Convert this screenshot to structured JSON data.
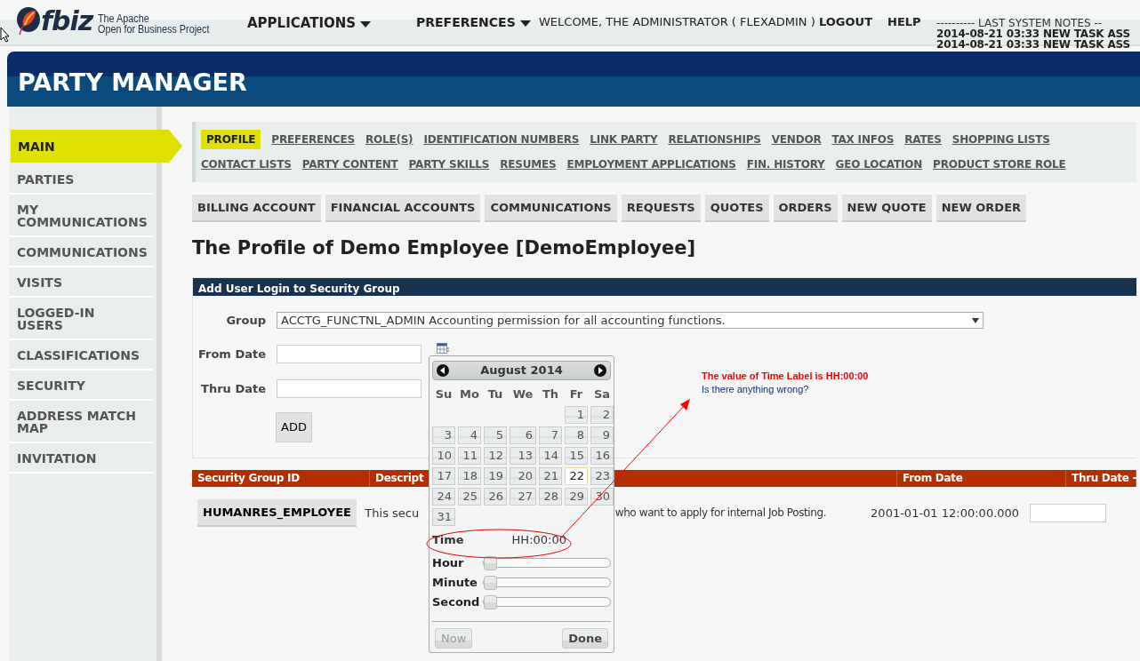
{
  "header": {
    "logo_text": "fbiz",
    "tagline": [
      "The Apache",
      "Open for Business Project"
    ],
    "menus": [
      {
        "label": "APPLICATIONS",
        "kind": "dropdown"
      },
      {
        "label": "PREFERENCES",
        "kind": "dropdown"
      },
      {
        "label": "WELCOME, THE ADMINISTRATOR ( FLEXADMIN )",
        "kind": "text"
      },
      {
        "label": "LOGOUT",
        "kind": "link"
      },
      {
        "label": "HELP",
        "kind": "link"
      }
    ],
    "system_notes": {
      "title": "---------- LAST SYSTEM NOTES --",
      "lines": [
        "2014-08-21 03:33 NEW TASK ASS",
        "2014-08-21 03:33 NEW TASK ASS"
      ]
    }
  },
  "app_title": "PARTY MANAGER",
  "sidebar": {
    "items": [
      {
        "label": "MAIN",
        "selected": true
      },
      {
        "label": "PARTIES",
        "selected": false
      },
      {
        "label": "MY COMMUNICATIONS",
        "selected": false
      },
      {
        "label": "COMMUNICATIONS",
        "selected": false
      },
      {
        "label": "VISITS",
        "selected": false
      },
      {
        "label": "LOGGED-IN USERS",
        "selected": false
      },
      {
        "label": "CLASSIFICATIONS",
        "selected": false
      },
      {
        "label": "SECURITY",
        "selected": false
      },
      {
        "label": "ADDRESS MATCH MAP",
        "selected": false
      },
      {
        "label": "INVITATION",
        "selected": false
      }
    ]
  },
  "tab_rows": [
    [
      {
        "label": "PROFILE",
        "selected": true
      },
      {
        "label": "PREFERENCES",
        "selected": false
      },
      {
        "label": "ROLE(S)",
        "selected": false
      },
      {
        "label": "IDENTIFICATION NUMBERS",
        "selected": false
      },
      {
        "label": "LINK PARTY",
        "selected": false
      },
      {
        "label": "RELATIONSHIPS",
        "selected": false
      },
      {
        "label": "VENDOR",
        "selected": false
      },
      {
        "label": "TAX INFOS",
        "selected": false
      },
      {
        "label": "RATES",
        "selected": false
      },
      {
        "label": "SHOPPING LISTS",
        "selected": false
      }
    ],
    [
      {
        "label": "CONTACT LISTS",
        "selected": false
      },
      {
        "label": "PARTY CONTENT",
        "selected": false
      },
      {
        "label": "PARTY SKILLS",
        "selected": false
      },
      {
        "label": "RESUMES",
        "selected": false
      },
      {
        "label": "EMPLOYMENT APPLICATIONS",
        "selected": false
      },
      {
        "label": "FIN. HISTORY",
        "selected": false
      },
      {
        "label": "GEO LOCATION",
        "selected": false
      },
      {
        "label": "PRODUCT STORE ROLE",
        "selected": false
      }
    ]
  ],
  "buttons": [
    "BILLING ACCOUNT",
    "FINANCIAL ACCOUNTS",
    "COMMUNICATIONS",
    "REQUESTS",
    "QUOTES",
    "ORDERS",
    "NEW QUOTE",
    "NEW ORDER"
  ],
  "page_title": "The Profile of Demo Employee [DemoEmployee]",
  "form": {
    "title": "Add User Login to Security Group",
    "fields": [
      {
        "label": "Group",
        "kind": "select",
        "value": "ACCTG_FUNCTNL_ADMIN Accounting permission for all accounting functions."
      },
      {
        "label": "From Date",
        "kind": "date",
        "picker_icon": true
      },
      {
        "label": "Thru Date",
        "kind": "date",
        "picker_icon": false
      }
    ],
    "submit": "ADD"
  },
  "table": {
    "columns": [
      "Security Group ID",
      "Descript",
      "From Date",
      "Thru Date -"
    ],
    "rows": [
      {
        "group_id": "HUMANRES_EMPLOYEE",
        "description_parts": [
          "This secu",
          "who want to apply for internal Job Posting."
        ],
        "from_date": "2001-01-01 12:00:00.000"
      }
    ]
  },
  "calendar": {
    "title": "August 2014",
    "weekdays": [
      "Su",
      "Mo",
      "Tu",
      "We",
      "Th",
      "Fr",
      "Sa"
    ],
    "weeks": [
      [
        {
          "label": "1",
          "today": false
        },
        {
          "label": "2",
          "today": false
        }
      ],
      [
        {
          "label": "3",
          "today": false
        },
        {
          "label": "4",
          "today": false
        },
        {
          "label": "5",
          "today": false
        },
        {
          "label": "6",
          "today": false
        },
        {
          "label": "7",
          "today": false
        },
        {
          "label": "8",
          "today": false
        },
        {
          "label": "9",
          "today": false
        }
      ],
      [
        {
          "label": "10",
          "today": false
        },
        {
          "label": "11",
          "today": false
        },
        {
          "label": "12",
          "today": false
        },
        {
          "label": "13",
          "today": false
        },
        {
          "label": "14",
          "today": false
        },
        {
          "label": "15",
          "today": false
        },
        {
          "label": "16",
          "today": false
        }
      ],
      [
        {
          "label": "17",
          "today": false
        },
        {
          "label": "18",
          "today": false
        },
        {
          "label": "19",
          "today": false
        },
        {
          "label": "20",
          "today": false
        },
        {
          "label": "21",
          "today": false
        },
        {
          "label": "22",
          "today": true
        },
        {
          "label": "23",
          "today": false
        }
      ],
      [
        {
          "label": "24",
          "today": false
        },
        {
          "label": "25",
          "today": false
        },
        {
          "label": "26",
          "today": false
        },
        {
          "label": "27",
          "today": false
        },
        {
          "label": "28",
          "today": false
        },
        {
          "label": "29",
          "today": false
        },
        {
          "label": "30",
          "today": false
        }
      ],
      [
        {
          "label": "31",
          "today": false
        }
      ]
    ],
    "time_label": "Time",
    "time_value": "HH:00:00",
    "sliders": [
      {
        "label": "Hour",
        "level": 0
      },
      {
        "label": "Minute",
        "level": 0
      },
      {
        "label": "Second",
        "level": 0
      }
    ],
    "buttons": [
      {
        "label": "Now",
        "disabled": true
      },
      {
        "label": "Done",
        "disabled": false
      }
    ]
  },
  "annotation": {
    "lines": [
      "The value of Time Label is HH:00:00",
      "Is there anything wrong?"
    ]
  }
}
